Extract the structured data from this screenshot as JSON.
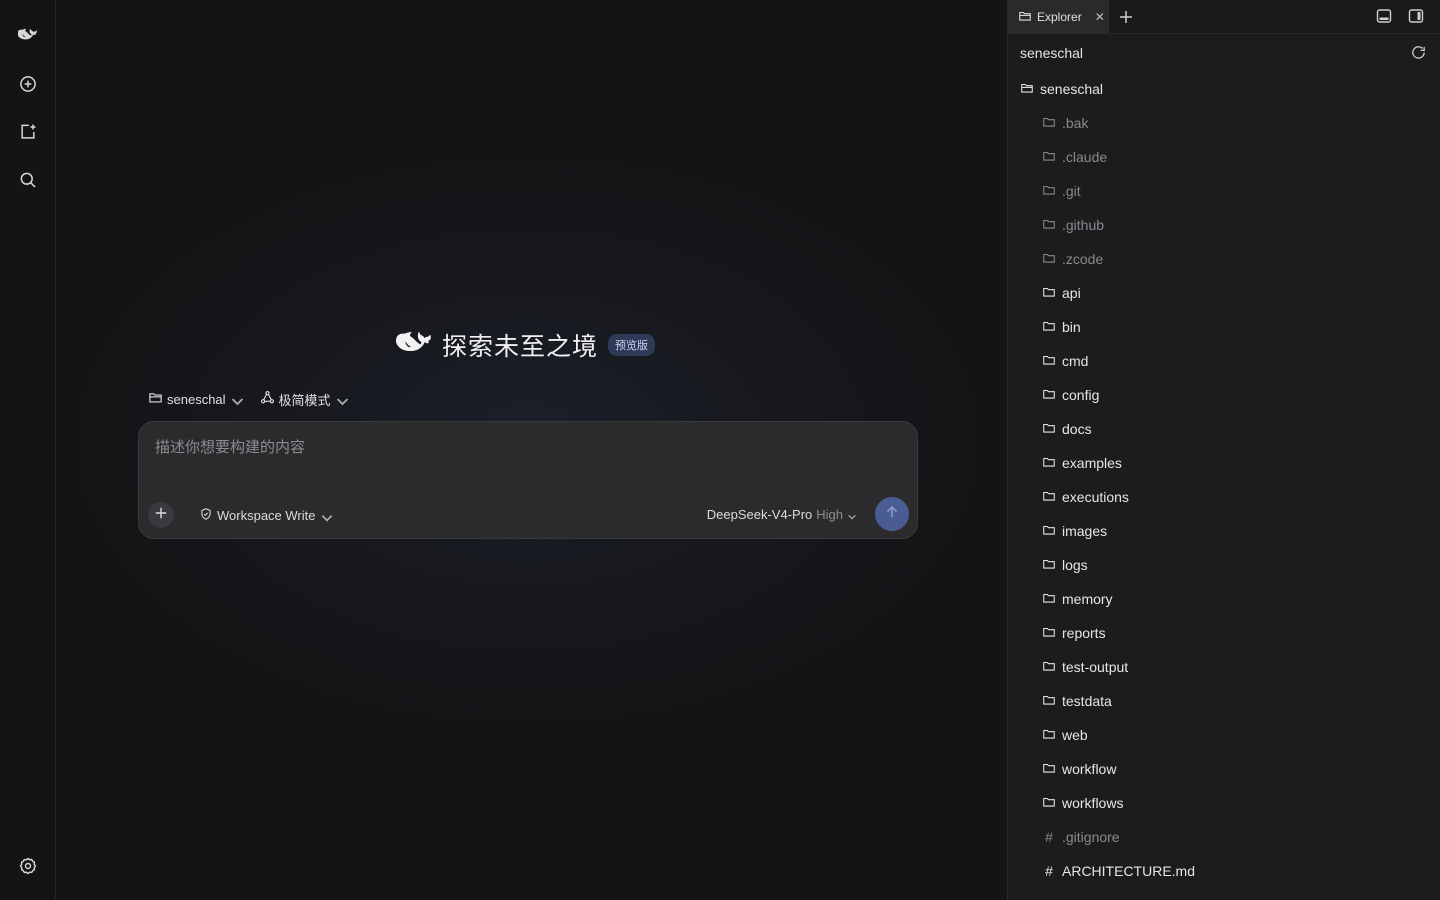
{
  "rail": {
    "items": [
      {
        "name": "app-logo-icon"
      },
      {
        "name": "new-chat-icon"
      },
      {
        "name": "new-project-icon"
      },
      {
        "name": "search-icon"
      }
    ],
    "settings": "settings-icon"
  },
  "hero": {
    "title": "探索未至之境",
    "badge": "预览版"
  },
  "chips": {
    "folder": "seneschal",
    "mode": "极简模式"
  },
  "composer": {
    "placeholder": "描述你想要构建的内容",
    "permission": "Workspace Write",
    "model": "DeepSeek-V4-Pro",
    "effort": "High"
  },
  "explorer": {
    "tab_label": "Explorer",
    "tab_close": "✕",
    "workspace": "seneschal",
    "root": "seneschal",
    "children": [
      {
        "label": ".bak",
        "kind": "folder",
        "dim": true
      },
      {
        "label": ".claude",
        "kind": "folder",
        "dim": true
      },
      {
        "label": ".git",
        "kind": "folder",
        "dim": true
      },
      {
        "label": ".github",
        "kind": "folder",
        "dim": true
      },
      {
        "label": ".zcode",
        "kind": "folder",
        "dim": true
      },
      {
        "label": "api",
        "kind": "folder",
        "dim": false
      },
      {
        "label": "bin",
        "kind": "folder",
        "dim": false
      },
      {
        "label": "cmd",
        "kind": "folder",
        "dim": false
      },
      {
        "label": "config",
        "kind": "folder",
        "dim": false
      },
      {
        "label": "docs",
        "kind": "folder",
        "dim": false
      },
      {
        "label": "examples",
        "kind": "folder",
        "dim": false
      },
      {
        "label": "executions",
        "kind": "folder",
        "dim": false
      },
      {
        "label": "images",
        "kind": "folder",
        "dim": false
      },
      {
        "label": "logs",
        "kind": "folder",
        "dim": false
      },
      {
        "label": "memory",
        "kind": "folder",
        "dim": false
      },
      {
        "label": "reports",
        "kind": "folder",
        "dim": false
      },
      {
        "label": "test-output",
        "kind": "folder",
        "dim": false
      },
      {
        "label": "testdata",
        "kind": "folder",
        "dim": false
      },
      {
        "label": "web",
        "kind": "folder",
        "dim": false
      },
      {
        "label": "workflow",
        "kind": "folder",
        "dim": false
      },
      {
        "label": "workflows",
        "kind": "folder",
        "dim": false
      },
      {
        "label": ".gitignore",
        "kind": "file",
        "dim": true
      },
      {
        "label": "ARCHITECTURE.md",
        "kind": "file",
        "dim": false
      }
    ]
  },
  "colors": {
    "accent": "#4a5c94",
    "badge_bg": "#2f3a57"
  }
}
